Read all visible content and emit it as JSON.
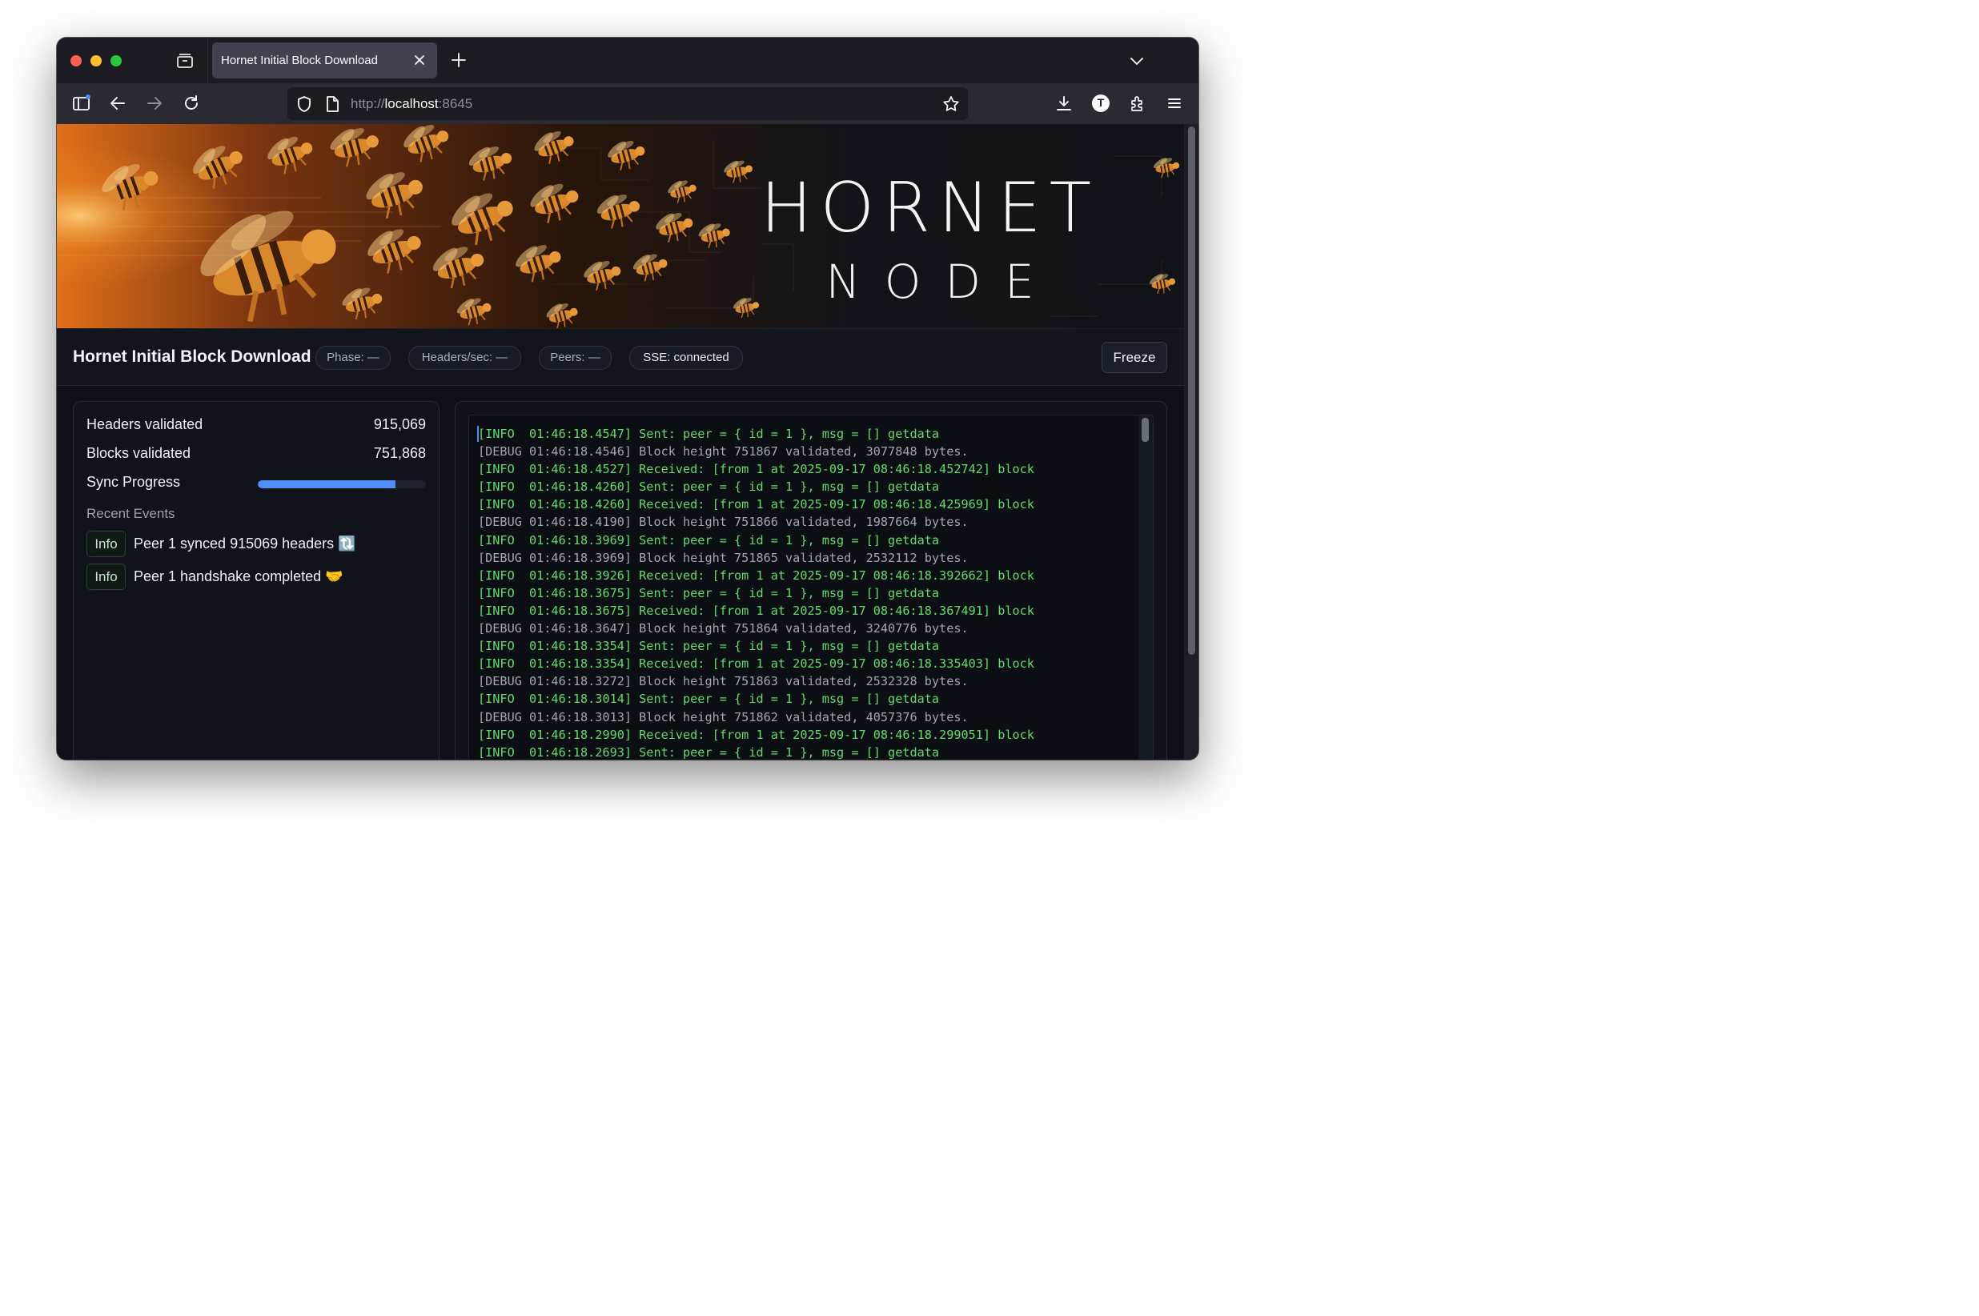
{
  "browser": {
    "tab_title": "Hornet Initial Block Download",
    "url_prefix": "http://",
    "url_host": "localhost",
    "url_port": ":8645",
    "profile_initial": "T"
  },
  "banner": {
    "logo_main": "HORNET",
    "logo_sub": "NODE"
  },
  "header": {
    "title": "Hornet Initial Block Download",
    "phase": "Phase: —",
    "headers_per_sec": "Headers/sec: —",
    "peers": "Peers: —",
    "sse": "SSE: connected",
    "freeze_label": "Freeze"
  },
  "stats": {
    "headers_label": "Headers validated",
    "headers_value": "915,069",
    "blocks_label": "Blocks validated",
    "blocks_value": "751,868",
    "sync_label": "Sync Progress",
    "sync_fraction": 0.82,
    "recent_title": "Recent Events"
  },
  "events": [
    {
      "level": "Info",
      "text": "Peer 1 synced 915069 headers 🔃"
    },
    {
      "level": "Info",
      "text": "Peer 1 handshake completed 🤝"
    }
  ],
  "colors": {
    "info_log": "#62dc6c",
    "debug_log": "#a3a7ad",
    "progress": "#4f8ef7"
  },
  "log": [
    {
      "level": "info",
      "text": "[INFO  01:46:18.4547] Sent: peer = { id = 1 }, msg = [] getdata"
    },
    {
      "level": "debug",
      "text": "[DEBUG 01:46:18.4546] Block height 751867 validated, 3077848 bytes."
    },
    {
      "level": "info",
      "text": "[INFO  01:46:18.4527] Received: [from 1 at 2025-09-17 08:46:18.452742] block"
    },
    {
      "level": "info",
      "text": "[INFO  01:46:18.4260] Sent: peer = { id = 1 }, msg = [] getdata"
    },
    {
      "level": "info",
      "text": "[INFO  01:46:18.4260] Received: [from 1 at 2025-09-17 08:46:18.425969] block"
    },
    {
      "level": "debug",
      "text": "[DEBUG 01:46:18.4190] Block height 751866 validated, 1987664 bytes."
    },
    {
      "level": "info",
      "text": "[INFO  01:46:18.3969] Sent: peer = { id = 1 }, msg = [] getdata"
    },
    {
      "level": "debug",
      "text": "[DEBUG 01:46:18.3969] Block height 751865 validated, 2532112 bytes."
    },
    {
      "level": "info",
      "text": "[INFO  01:46:18.3926] Received: [from 1 at 2025-09-17 08:46:18.392662] block"
    },
    {
      "level": "info",
      "text": "[INFO  01:46:18.3675] Sent: peer = { id = 1 }, msg = [] getdata"
    },
    {
      "level": "info",
      "text": "[INFO  01:46:18.3675] Received: [from 1 at 2025-09-17 08:46:18.367491] block"
    },
    {
      "level": "debug",
      "text": "[DEBUG 01:46:18.3647] Block height 751864 validated, 3240776 bytes."
    },
    {
      "level": "info",
      "text": "[INFO  01:46:18.3354] Sent: peer = { id = 1 }, msg = [] getdata"
    },
    {
      "level": "info",
      "text": "[INFO  01:46:18.3354] Received: [from 1 at 2025-09-17 08:46:18.335403] block"
    },
    {
      "level": "debug",
      "text": "[DEBUG 01:46:18.3272] Block height 751863 validated, 2532328 bytes."
    },
    {
      "level": "info",
      "text": "[INFO  01:46:18.3014] Sent: peer = { id = 1 }, msg = [] getdata"
    },
    {
      "level": "debug",
      "text": "[DEBUG 01:46:18.3013] Block height 751862 validated, 4057376 bytes."
    },
    {
      "level": "info",
      "text": "[INFO  01:46:18.2990] Received: [from 1 at 2025-09-17 08:46:18.299051] block"
    },
    {
      "level": "info",
      "text": "[INFO  01:46:18.2693] Sent: peer = { id = 1 }, msg = [] getdata"
    }
  ]
}
